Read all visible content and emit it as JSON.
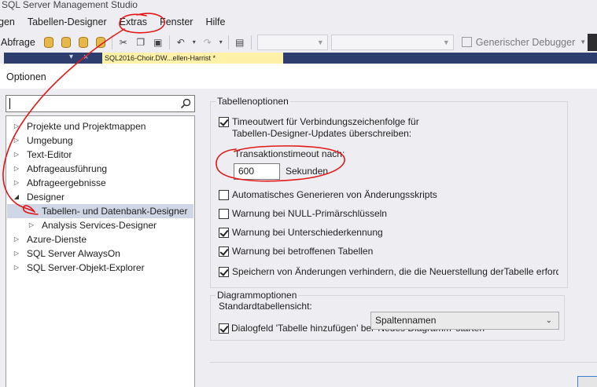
{
  "window": {
    "title": "SQL Server Management Studio"
  },
  "menu": {
    "items": [
      "gen",
      "Tabellen-Designer",
      "Extras",
      "Fenster",
      "Hilfe"
    ]
  },
  "toolbar": {
    "query_label": "Abfrage",
    "debugger_label": "Generischer Debugger"
  },
  "tabs": {
    "document_tab": "SQL2016-Choir.DW...ellen-Harrist *"
  },
  "dialog": {
    "title": "Optionen",
    "search": {
      "value": "",
      "placeholder": ""
    },
    "tree": [
      {
        "label": "Projekte und Projektmappen",
        "expanded": false,
        "level": 0
      },
      {
        "label": "Umgebung",
        "expanded": false,
        "level": 0
      },
      {
        "label": "Text-Editor",
        "expanded": false,
        "level": 0
      },
      {
        "label": "Abfrageausführung",
        "expanded": false,
        "level": 0
      },
      {
        "label": "Abfrageergebnisse",
        "expanded": false,
        "level": 0
      },
      {
        "label": "Designer",
        "expanded": true,
        "level": 0
      },
      {
        "label": "Tabellen- und Datenbank-Designer",
        "expanded": false,
        "level": 1,
        "selected": true,
        "leaf": true
      },
      {
        "label": "Analysis Services-Designer",
        "expanded": false,
        "level": 1
      },
      {
        "label": "Azure-Dienste",
        "expanded": false,
        "level": 0
      },
      {
        "label": "SQL Server AlwaysOn",
        "expanded": false,
        "level": 0
      },
      {
        "label": "SQL Server-Objekt-Explorer",
        "expanded": false,
        "level": 0
      }
    ],
    "table_options": {
      "title": "Tabellenoptionen",
      "timeout_override": {
        "label_line1": "Timeoutwert für Verbindungszeichenfolge für",
        "label_line2": "Tabellen-Designer-Updates überschreiben:",
        "checked": true
      },
      "transaction_timeout": {
        "label": "Transaktionstimeout nach:",
        "value": "600",
        "unit": "Sekunden"
      },
      "checkboxes": [
        {
          "label": "Automatisches Generieren von Änderungsskripts",
          "checked": false
        },
        {
          "label": "Warnung bei NULL-Primärschlüsseln",
          "checked": false
        },
        {
          "label": "Warnung bei Unterschiederkennung",
          "checked": true
        },
        {
          "label": "Warnung bei betroffenen Tabellen",
          "checked": true
        },
        {
          "label": "Speichern von Änderungen verhindern, die die Neuerstellung derTabelle erford",
          "checked": true
        }
      ]
    },
    "diagram_options": {
      "title": "Diagrammoptionen",
      "default_view_label": "Standardtabellensicht:",
      "default_view_value": "Spaltennamen",
      "add_table_dialog": {
        "label": "Dialogfeld 'Tabelle hinzufügen' bei 'Neues Diagramm' starten",
        "checked": true
      }
    }
  },
  "colors": {
    "annotation": "#e01818",
    "selection": "#cfd6e5",
    "tab_highlight": "#fff1a8"
  }
}
